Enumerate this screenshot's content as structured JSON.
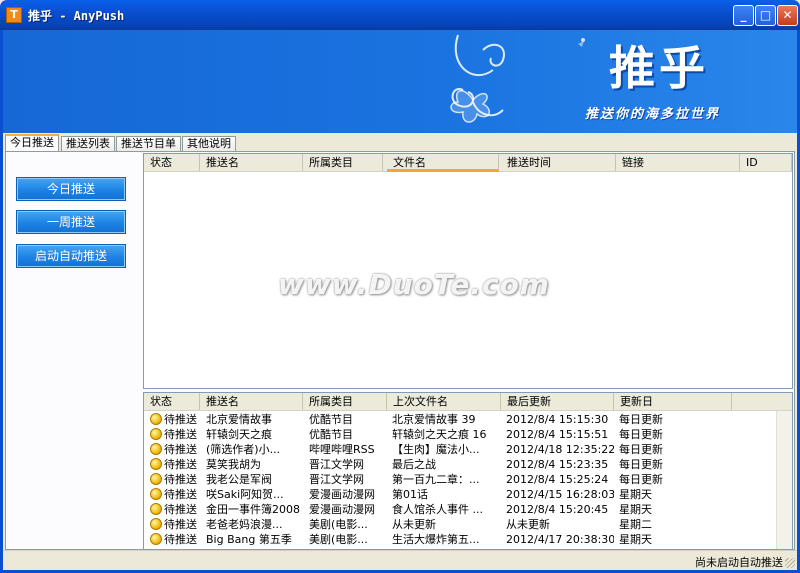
{
  "window": {
    "title": "推乎 - AnyPush",
    "icon_letter": "T",
    "minimize": "_",
    "maximize": "□",
    "close": "✕"
  },
  "banner": {
    "brand": "推乎",
    "slogan": "推送你的海多拉世界"
  },
  "tabs": [
    {
      "label": "今日推送",
      "active": true
    },
    {
      "label": "推送列表",
      "active": false
    },
    {
      "label": "推送节目单",
      "active": false
    },
    {
      "label": "其他说明",
      "active": false
    }
  ],
  "left_buttons": {
    "today": "今日推送",
    "week": "一周推送",
    "auto": "启动自动推送"
  },
  "top_list": {
    "columns": [
      "状态",
      "推送名",
      "所属类目",
      "文件名",
      "推送时间",
      "链接",
      "ID"
    ],
    "sorted_column": "文件名"
  },
  "watermark": "www.DuoTe.com",
  "bottom_list": {
    "columns": [
      "状态",
      "推送名",
      "所属类目",
      "上次文件名",
      "最后更新",
      "更新日"
    ],
    "rows": [
      {
        "status": "待推送",
        "name": "北京爱情故事",
        "category": "优酷节目",
        "last_file": "北京爱情故事 39",
        "updated": "2012/8/4 15:15:30",
        "day": "每日更新"
      },
      {
        "status": "待推送",
        "name": "轩辕剑天之痕",
        "category": "优酷节目",
        "last_file": "轩辕剑之天之痕 16",
        "updated": "2012/8/4 15:15:51",
        "day": "每日更新"
      },
      {
        "status": "待推送",
        "name": "(筛选作者)小...",
        "category": "哔哩哔哩RSS",
        "last_file": "【生肉】魔法小...",
        "updated": "2012/4/18 12:35:22",
        "day": "每日更新"
      },
      {
        "status": "待推送",
        "name": "莫笑我胡为",
        "category": "晋江文学网",
        "last_file": "最后之战",
        "updated": "2012/8/4 15:23:35",
        "day": "每日更新"
      },
      {
        "status": "待推送",
        "name": "我老公是军阀",
        "category": "晋江文学网",
        "last_file": "第一百九二章：...",
        "updated": "2012/8/4 15:25:24",
        "day": "每日更新"
      },
      {
        "status": "待推送",
        "name": "咲Saki阿知贺...",
        "category": "爱漫画动漫网",
        "last_file": "第01话",
        "updated": "2012/4/15 16:28:03",
        "day": "星期天"
      },
      {
        "status": "待推送",
        "name": "金田一事件簿2008",
        "category": "爱漫画动漫网",
        "last_file": "食人馆杀人事件 ...",
        "updated": "2012/8/4 15:20:45",
        "day": "星期天"
      },
      {
        "status": "待推送",
        "name": "老爸老妈浪漫...",
        "category": "美剧(电影...",
        "last_file": "从未更新",
        "updated": "从未更新",
        "day": "星期二"
      },
      {
        "status": "待推送",
        "name": "Big Bang 第五季",
        "category": "美剧(电影...",
        "last_file": "生活大爆炸第五...",
        "updated": "2012/4/17 20:38:30",
        "day": "星期天"
      }
    ]
  },
  "statusbar": {
    "text": "尚未启动自动推送"
  }
}
